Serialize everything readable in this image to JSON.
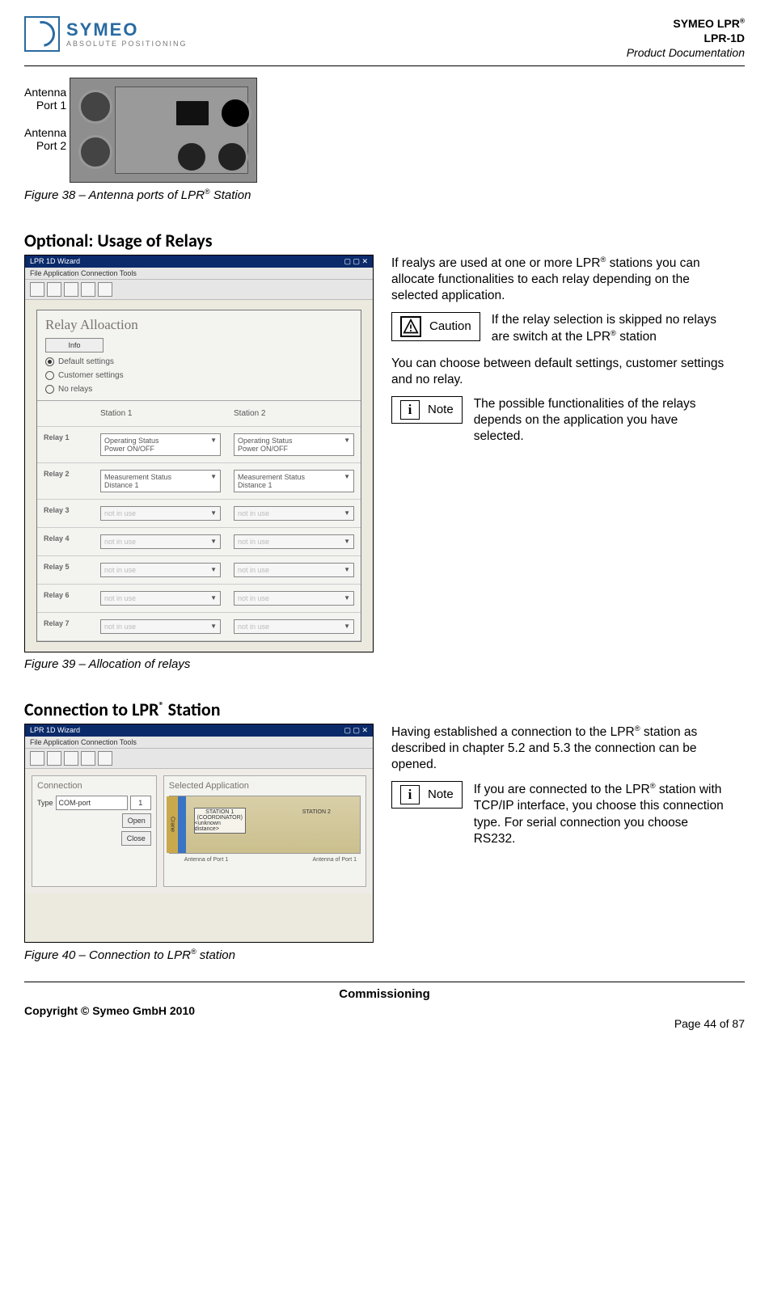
{
  "header": {
    "logo_main": "SYMEO",
    "logo_sub": "ABSOLUTE POSITIONING",
    "line1_pre": "SYMEO LPR",
    "line2": "LPR-1D",
    "line3": "Product Documentation"
  },
  "antenna": {
    "label1a": "Antenna",
    "label1b": "Port 1",
    "label2a": "Antenna",
    "label2b": "Port 2"
  },
  "fig38_pre": "Figure 38 – Antenna ports of LPR",
  "fig38_post": " Station",
  "sectionA": "Optional: Usage of Relays",
  "wizard": {
    "title": "LPR 1D Wizard",
    "menu": "File   Application   Connection   Tools",
    "relay_heading": "Relay Alloaction",
    "info_btn": "Info",
    "opt_default": "Default settings",
    "opt_customer": "Customer settings",
    "opt_norelays": "No relays",
    "col_station1": "Station 1",
    "col_station2": "Station 2",
    "rows": [
      "Relay 1",
      "Relay 2",
      "Relay 3",
      "Relay 4",
      "Relay 5",
      "Relay 6",
      "Relay 7"
    ],
    "dd_r1a": "Operating Status",
    "dd_r1b": "Power ON/OFF",
    "dd_r2a": "Measurement Status",
    "dd_r2b": "Distance 1",
    "dd_notinuse": "not in use"
  },
  "textA": {
    "p1_pre": "If realys are used at one or more LPR",
    "p1_post": " stations you can allocate functionalities to each relay depending on the selected application.",
    "caution_label": "Caution",
    "caution_text_pre": "If the relay selection is skipped no relays are switch at the LPR",
    "caution_text_post": " station",
    "p2": "You can choose between default settings, customer settings and no relay.",
    "note_label": "Note",
    "note_text": "The possible functionalities of the relays depends on the application you have selected."
  },
  "fig39": "Figure 39 – Allocation of relays",
  "sectionB_pre": "Connection to LPR",
  "sectionB_post": " Station",
  "conn": {
    "title": "LPR 1D Wizard",
    "menu": "File   Application   Connection   Tools",
    "left_title": "Connection",
    "type_lbl": "Type",
    "type_val": "COM-port",
    "port_val": "1",
    "open_btn": "Open",
    "close_btn": "Close",
    "right_title": "Selected Application",
    "crane": "Crane",
    "st1_l1": "STATION 1",
    "st1_l2": "(COORDINATOR)",
    "st1_l3": "<unknown distance>",
    "st2": "STATION 2",
    "axisL": "Antenna of Port 1",
    "axisR": "Antenna of Port 1"
  },
  "textB": {
    "p1_pre": "Having established a connection to the LPR",
    "p1_post": " station as described in chapter 5.2 and 5.3 the connection can be opened.",
    "note_label": "Note",
    "note_text_pre": "If you are connected to the LPR",
    "note_text_post": " station with TCP/IP interface, you choose this connection type. For serial connection you choose RS232."
  },
  "fig40_pre": "Figure 40 – Connection to LPR",
  "fig40_post": " station",
  "footer": {
    "section": "Commissioning",
    "copyright": "Copyright © Symeo GmbH 2010",
    "page": "Page 44 of 87"
  }
}
